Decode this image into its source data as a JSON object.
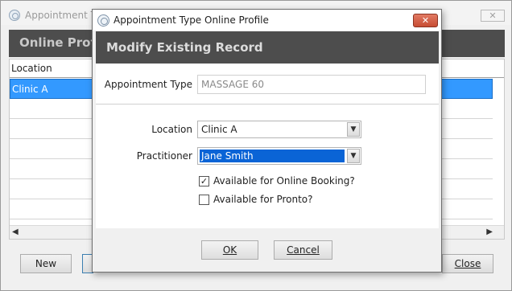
{
  "background_window": {
    "title": "Appointment Type Online Profile",
    "close_label": "✕",
    "header_title": "Online Profile",
    "grid": {
      "column_header": "Location",
      "rows": [
        "Clinic A"
      ]
    },
    "buttons": {
      "new_label": "New",
      "close_label": "Close"
    }
  },
  "dialog": {
    "title": "Appointment Type Online Profile",
    "close_label": "✕",
    "header_title": "Modify Existing Record",
    "appointment_type": {
      "label": "Appointment Type",
      "value": "MASSAGE 60"
    },
    "location": {
      "label": "Location",
      "value": "Clinic A"
    },
    "practitioner": {
      "label": "Practitioner",
      "value": "Jane Smith"
    },
    "online_booking": {
      "label": "Available for Online Booking?",
      "checked": true
    },
    "pronto": {
      "label": "Available for Pronto?",
      "checked": false
    },
    "buttons": {
      "ok_label": "OK",
      "cancel_label": "Cancel"
    }
  },
  "icons": {
    "app": "app-logo-icon",
    "close": "close-icon",
    "dropdown": "chevron-down-icon",
    "scroll_left": "arrow-left-icon",
    "scroll_right": "arrow-right-icon",
    "check": "check-icon"
  },
  "colors": {
    "header_bg": "#4d4d4d",
    "selection": "#3399ff",
    "combo_selection": "#0a64d6",
    "close_button": "#c74c33"
  }
}
